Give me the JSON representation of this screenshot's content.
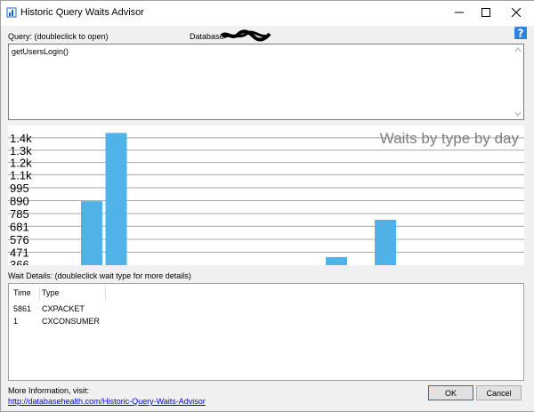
{
  "window": {
    "title": "Historic Query Waits Advisor"
  },
  "query": {
    "label": "Query: (doubleclick to open)",
    "text": "getUsersLogin()"
  },
  "database": {
    "label": "Database"
  },
  "chart_data": {
    "type": "bar",
    "title": "Waits by type by day",
    "y_tick_labels": [
      "1.4k",
      "1.3k",
      "1.2k",
      "1.1k",
      "995",
      "890",
      "785",
      "681",
      "576",
      "471"
    ],
    "y_ticks": [
      1400,
      1300,
      1200,
      1100,
      995,
      890,
      785,
      681,
      576,
      471
    ],
    "ylim": [
      366,
      1450
    ],
    "grid": true,
    "bar_color": "#4fb3e8",
    "bars": [
      {
        "slot": 0,
        "value": 885
      },
      {
        "slot": 1,
        "value": 1440
      },
      {
        "slot": 2,
        "value": 0
      },
      {
        "slot": 3,
        "value": 0
      },
      {
        "slot": 4,
        "value": 0
      },
      {
        "slot": 5,
        "value": 0
      },
      {
        "slot": 6,
        "value": 0
      },
      {
        "slot": 7,
        "value": 0
      },
      {
        "slot": 8,
        "value": 0
      },
      {
        "slot": 9,
        "value": 0
      },
      {
        "slot": 10,
        "value": 432
      },
      {
        "slot": 11,
        "value": 0
      },
      {
        "slot": 12,
        "value": 735
      }
    ]
  },
  "wait_details": {
    "label": "Wait Details: (doubleclick wait type for more details)",
    "columns": [
      "Time",
      "Type"
    ],
    "rows": [
      {
        "time": "5861",
        "type": "CXPACKET"
      },
      {
        "time": "1",
        "type": "CXCONSUMER"
      }
    ]
  },
  "footer": {
    "more_info": "More Information, visit:",
    "link": "http://databasehealth.com/Historic-Query-Waits-Advisor",
    "ok_label": "OK",
    "cancel_label": "Cancel"
  },
  "icons": {
    "app": "app-icon",
    "help": "help-icon",
    "minimize": "minimize-icon",
    "maximize": "maximize-icon",
    "close": "close-icon"
  }
}
